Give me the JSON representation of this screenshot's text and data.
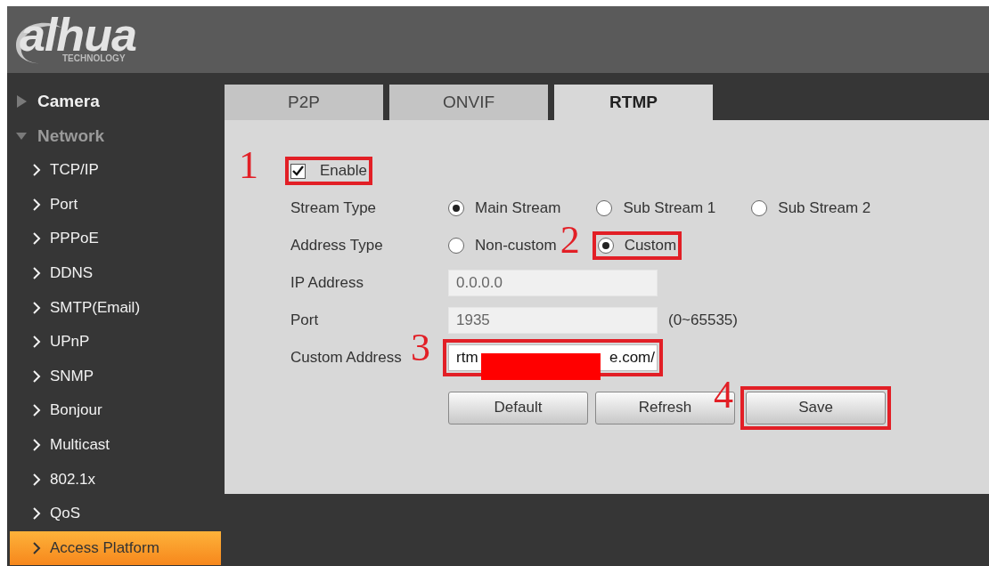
{
  "header": {
    "logo": "alhua",
    "logo_sub": "TECHNOLOGY"
  },
  "sidebar": {
    "items": [
      {
        "label": "Camera",
        "expanded": false
      },
      {
        "label": "Network",
        "expanded": true,
        "children": [
          {
            "label": "TCP/IP",
            "selected": false
          },
          {
            "label": "Port",
            "selected": false
          },
          {
            "label": "PPPoE",
            "selected": false
          },
          {
            "label": "DDNS",
            "selected": false
          },
          {
            "label": "SMTP(Email)",
            "selected": false
          },
          {
            "label": "UPnP",
            "selected": false
          },
          {
            "label": "SNMP",
            "selected": false
          },
          {
            "label": "Bonjour",
            "selected": false
          },
          {
            "label": "Multicast",
            "selected": false
          },
          {
            "label": "802.1x",
            "selected": false
          },
          {
            "label": "QoS",
            "selected": false
          },
          {
            "label": "Access Platform",
            "selected": true
          }
        ]
      }
    ]
  },
  "tabs": [
    {
      "label": "P2P",
      "selected": false
    },
    {
      "label": "ONVIF",
      "selected": false
    },
    {
      "label": "RTMP",
      "selected": true
    }
  ],
  "form": {
    "enable": {
      "label": "Enable",
      "checked": true,
      "annotation": "1"
    },
    "stream_type": {
      "label": "Stream Type",
      "options": [
        {
          "label": "Main Stream",
          "selected": true
        },
        {
          "label": "Sub Stream 1",
          "selected": false
        },
        {
          "label": "Sub Stream 2",
          "selected": false
        }
      ]
    },
    "address_type": {
      "label": "Address Type",
      "options": [
        {
          "label": "Non-custom",
          "selected": false
        },
        {
          "label": "Custom",
          "selected": true,
          "annotation": "2"
        }
      ]
    },
    "ip_address": {
      "label": "IP Address",
      "value": "0.0.0.0",
      "disabled": true
    },
    "port": {
      "label": "Port",
      "value": "1935",
      "disabled": true,
      "hint": "(0~65535)"
    },
    "custom_address": {
      "label": "Custom Address",
      "value_start": "rtm",
      "value_end": "e.com/",
      "redacted": true,
      "annotation": "3"
    },
    "buttons": [
      {
        "label": "Default"
      },
      {
        "label": "Refresh"
      },
      {
        "label": "Save",
        "annotation": "4"
      }
    ]
  }
}
